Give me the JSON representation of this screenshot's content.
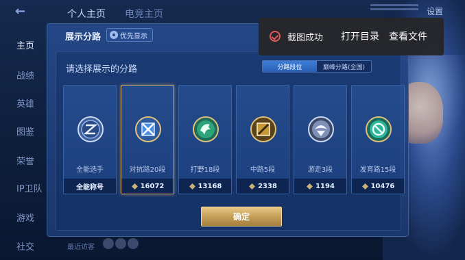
{
  "topbar": {
    "tabs": [
      "个人主页",
      "电竞主页"
    ],
    "settings_label": "设置"
  },
  "sidebar": {
    "items": [
      {
        "label": "主页",
        "active": true
      },
      {
        "label": "战绩",
        "active": false
      },
      {
        "label": "英雄",
        "active": false
      },
      {
        "label": "图鉴",
        "active": false
      },
      {
        "label": "荣誉",
        "active": false
      },
      {
        "label": "IP卫队",
        "active": false
      },
      {
        "label": "游戏",
        "active": false
      },
      {
        "label": "社交",
        "active": false
      }
    ]
  },
  "panel": {
    "title": "展示分路",
    "priority_button_label": "优先显示",
    "prompt": "请选择展示的分路",
    "segment": {
      "options": [
        "分路段位",
        "巅峰分路(全国)"
      ],
      "selected": "分路段位"
    },
    "cards": [
      {
        "lane": "全能选手",
        "footer": "全能称号",
        "score": null,
        "emblem_color": "#8fb3e8",
        "selected": false
      },
      {
        "lane": "对抗路20段",
        "footer": null,
        "score": "16072",
        "emblem_color": "#4d8ee0",
        "selected": true
      },
      {
        "lane": "打野18段",
        "footer": null,
        "score": "13168",
        "emblem_color": "#2fa37a",
        "selected": false
      },
      {
        "lane": "中路5段",
        "footer": null,
        "score": "2338",
        "emblem_color": "#c79b3a",
        "selected": false
      },
      {
        "lane": "游走3段",
        "footer": null,
        "score": "1194",
        "emblem_color": "#7f8fb5",
        "selected": false
      },
      {
        "lane": "发育路15段",
        "footer": null,
        "score": "10476",
        "emblem_color": "#2fb59a",
        "selected": false
      }
    ],
    "confirm_label": "确定"
  },
  "bottom": {
    "recent_visitors": "最近访客"
  },
  "toast": {
    "message": "截图成功",
    "actions": [
      "打开目录",
      "查看文件"
    ],
    "accent_color": "#e45a5a"
  }
}
